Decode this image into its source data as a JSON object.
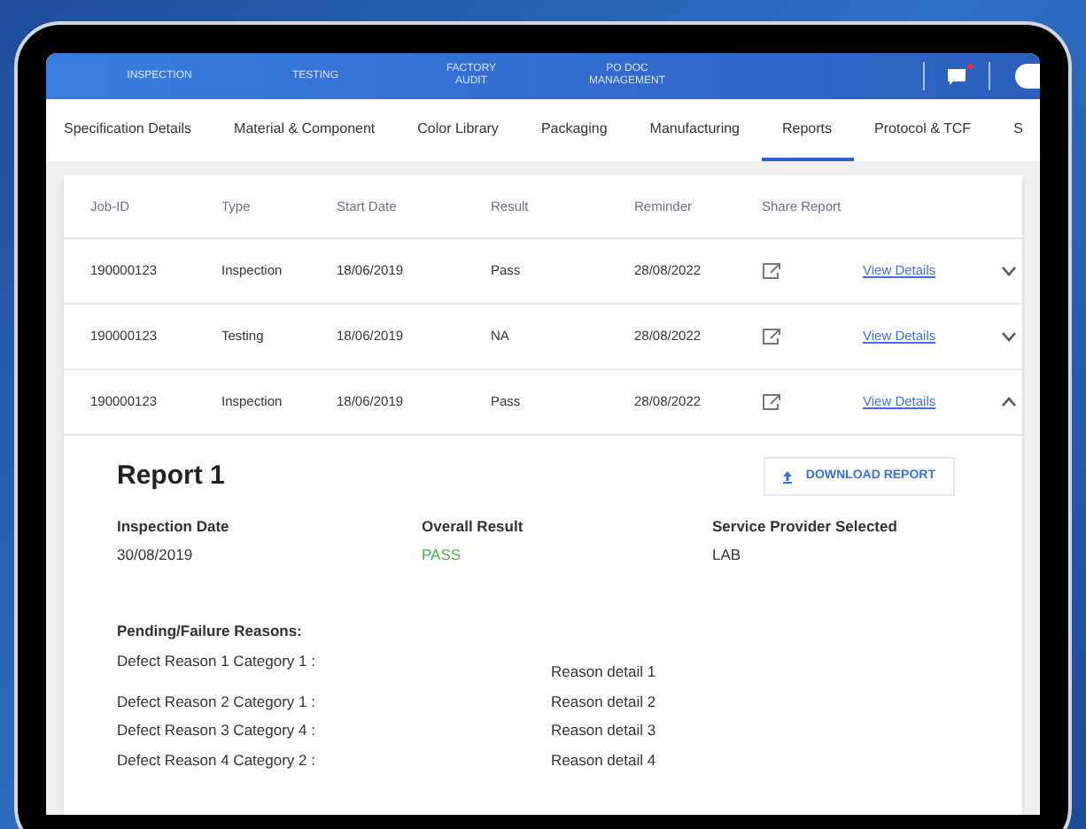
{
  "top_nav": {
    "items": [
      {
        "label": "INSPECTION"
      },
      {
        "label": "TESTING"
      },
      {
        "label": "FACTORY\nAUDIT"
      },
      {
        "label": "PO DOC\nMANAGEMENT"
      }
    ],
    "notification": true
  },
  "tabs": [
    {
      "label": "Specification Details",
      "selected": false
    },
    {
      "label": "Material & Component",
      "selected": false
    },
    {
      "label": "Color Library",
      "selected": false
    },
    {
      "label": "Packaging",
      "selected": false
    },
    {
      "label": "Manufacturing",
      "selected": false
    },
    {
      "label": "Reports",
      "selected": true
    },
    {
      "label": "Protocol & TCF",
      "selected": false
    },
    {
      "label": "S",
      "selected": false
    }
  ],
  "table": {
    "columns": [
      "Job-ID",
      "Type",
      "Start Date",
      "Result",
      "Reminder",
      "Share Report"
    ],
    "rows": [
      {
        "job_id": "190000123",
        "type": "Inspection",
        "start_date": "18/06/2019",
        "result": "Pass",
        "reminder": "28/08/2022",
        "link": "View Details",
        "expanded": false
      },
      {
        "job_id": "190000123",
        "type": "Testing",
        "start_date": "18/06/2019",
        "result": "NA",
        "reminder": "28/08/2022",
        "link": "View Details",
        "expanded": false
      },
      {
        "job_id": "190000123",
        "type": "Inspection",
        "start_date": "18/06/2019",
        "result": "Pass",
        "reminder": "28/08/2022",
        "link": "View Details",
        "expanded": true
      }
    ]
  },
  "report": {
    "title": "Report 1",
    "download_button": "DOWNLOAD REPORT",
    "fields": [
      {
        "label": "Inspection Date",
        "value": "30/08/2019",
        "kind": "plain"
      },
      {
        "label": "Overall Result",
        "value": "PASS",
        "kind": "pass"
      },
      {
        "label": "Service Provider Selected",
        "value": "LAB",
        "kind": "plain"
      }
    ],
    "reasons_heading": "Pending/Failure Reasons:",
    "reasons": [
      {
        "category": "Defect Reason 1 Category 1 :",
        "detail": "Reason detail 1"
      },
      {
        "category": "Defect Reason 2 Category 1 :",
        "detail": "Reason detail 2"
      },
      {
        "category": "Defect Reason 3 Category 4 :",
        "detail": "Reason detail 3"
      },
      {
        "category": "Defect Reason 4 Category 2 :",
        "detail": "Reason detail 4"
      }
    ]
  }
}
